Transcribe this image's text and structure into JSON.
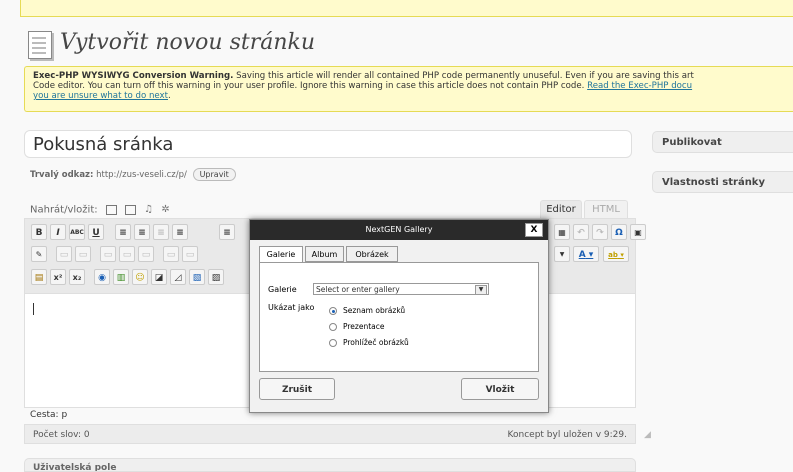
{
  "page": {
    "title": "Vytvořit novou stránku"
  },
  "warning": {
    "strong": "Exec-PHP WYSIWYG Conversion Warning.",
    "text1": " Saving this article will render all contained PHP code permanently unuseful. Even if you are saving this art",
    "text2": "Code editor. You can turn off this warning in your user profile. Ignore this warning in case this article does not contain PHP code. ",
    "link1": "Read the Exec-PHP docu",
    "link2": "you are unsure what to do next",
    "tail": "."
  },
  "post": {
    "title_value": "Pokusná sránka",
    "permalink_label": "Trvalý odkaz:",
    "permalink_url": "http://zus-veseli.cz/p/",
    "edit_button": "Upravit"
  },
  "sidebar": {
    "publish": "Publikovat",
    "page_attributes": "Vlastnosti stránky"
  },
  "editor": {
    "upload_label": "Nahrát/vložit:",
    "tab_visual": "Editor",
    "tab_html": "HTML",
    "path": "Cesta: p",
    "word_count": "Počet slov: 0",
    "draft_saved": "Koncept byl uložen v 9:29."
  },
  "toolbar": {
    "row1": [
      "B",
      "I",
      "ABC",
      "U",
      "≡",
      "≡",
      "≡",
      "≡",
      "≡"
    ],
    "row1_right": [
      "▦",
      "↶",
      "↷",
      "Ω",
      "▣"
    ],
    "row3": [
      "▤",
      "x²",
      "x₂",
      "◉",
      "▥",
      "☺",
      "◪",
      "◿",
      "▧",
      "▨"
    ],
    "font_color": "A",
    "bg_color": "ab"
  },
  "bottom_box": {
    "title": "Uživatelská pole"
  },
  "modal": {
    "title": "NextGEN Gallery",
    "close": "X",
    "tabs": [
      "Galerie",
      "Album",
      "Obrázek"
    ],
    "gallery_label": "Galerie",
    "gallery_select": "Select or enter gallery",
    "show_as_label": "Ukázat jako",
    "options": [
      "Seznam obrázků",
      "Prezentace",
      "Prohlížeč obrázků"
    ],
    "selected_option": "Seznam obrázků",
    "cancel": "Zrušit",
    "insert": "Vložit"
  },
  "colors": {
    "warning_bg": "#fffbcc",
    "warning_border": "#e6db55",
    "modal_titlebar": "#2a2a2a",
    "link": "#21759b"
  }
}
